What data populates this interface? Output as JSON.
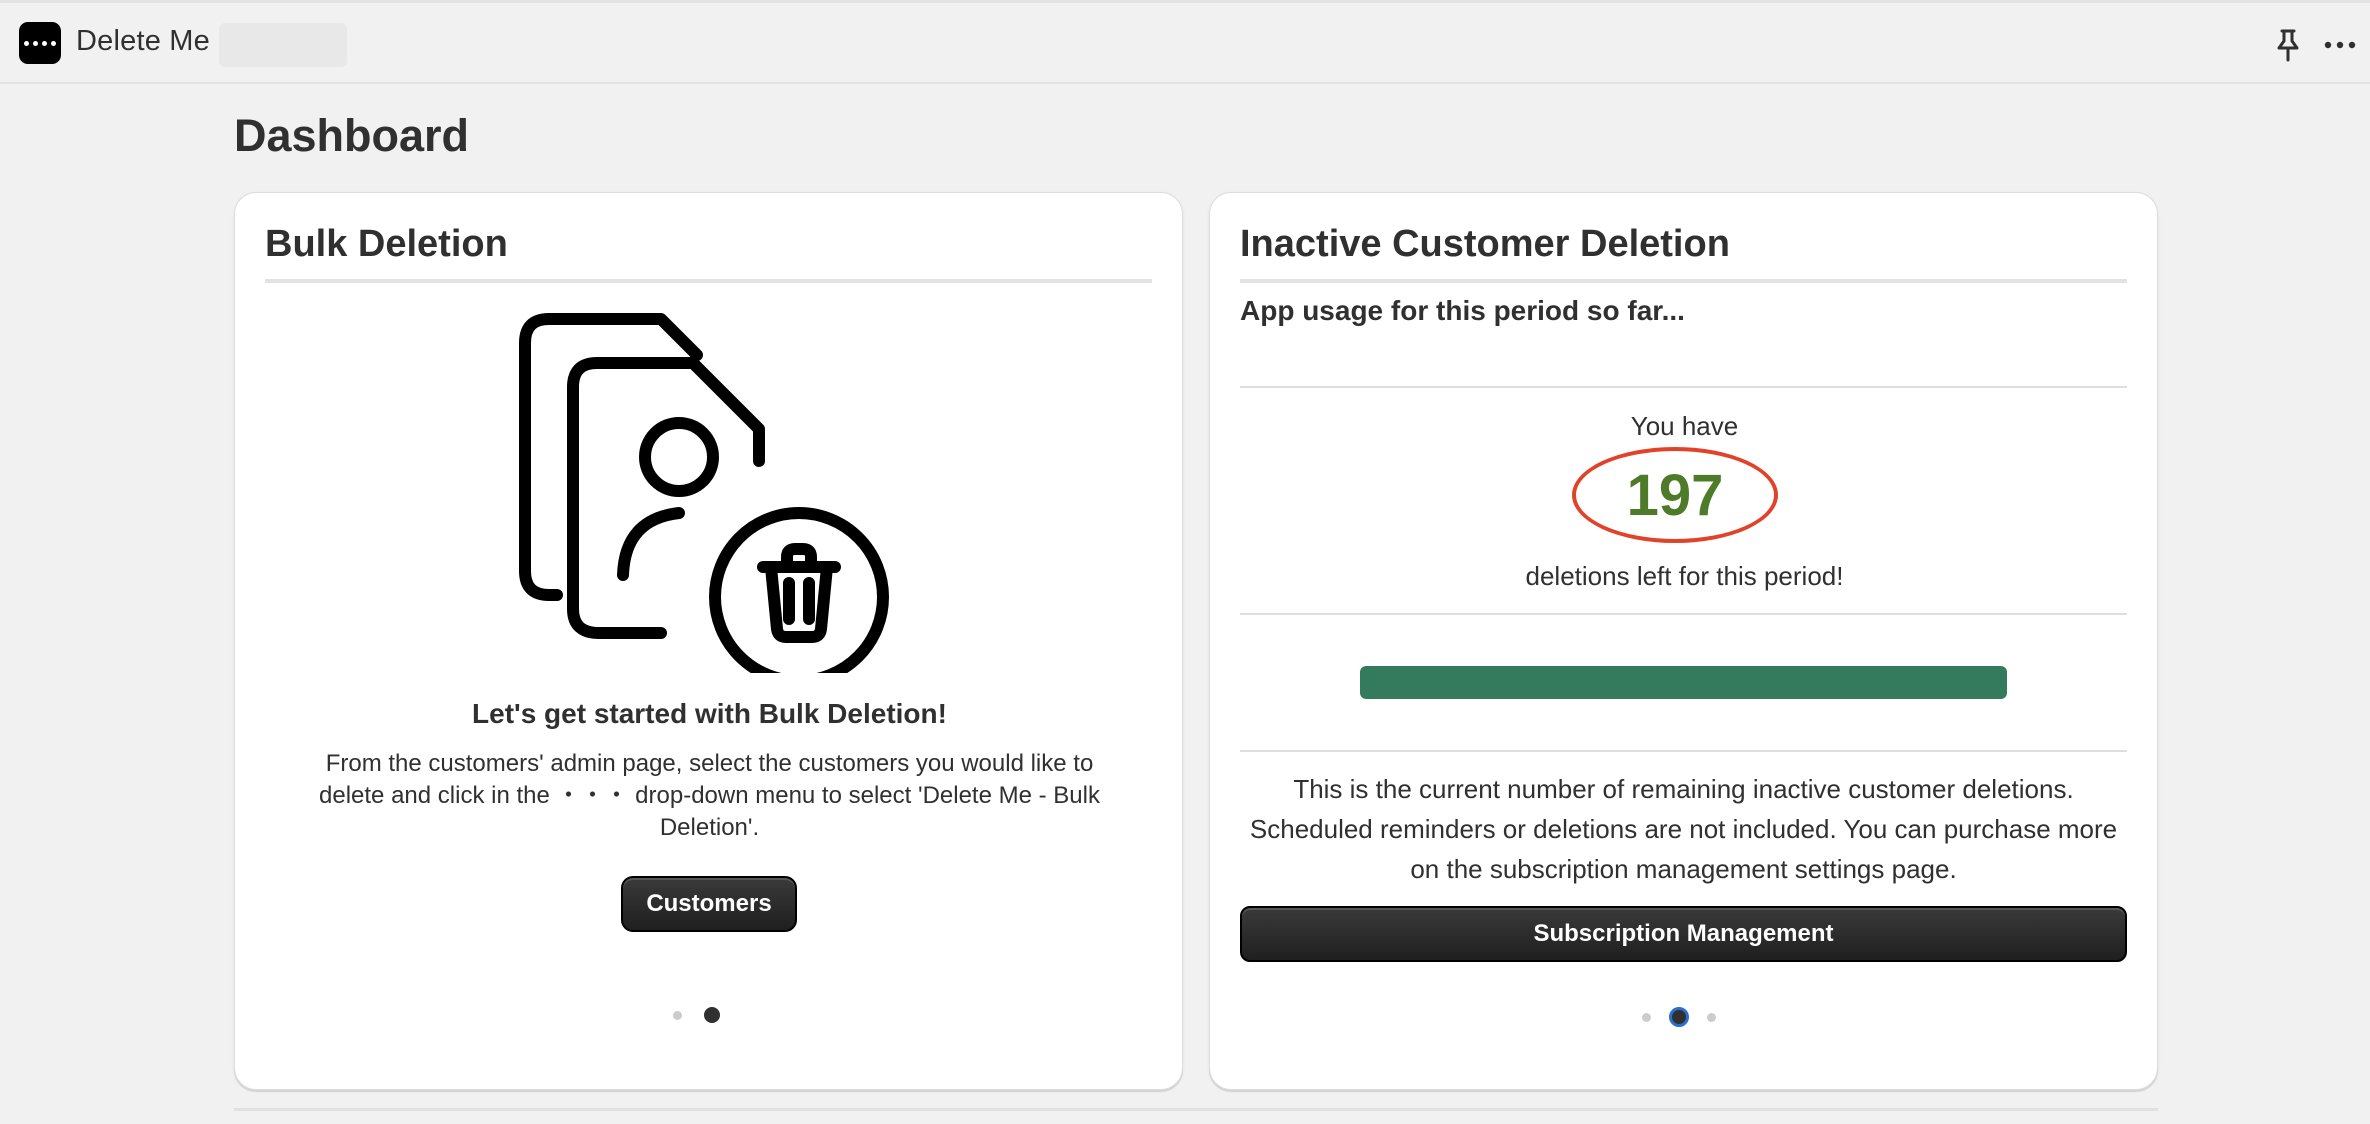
{
  "app": {
    "title": "Delete Me",
    "icon": "app-menu-dots-icon"
  },
  "topbar": {
    "pin_icon": "pin-icon",
    "more_icon": "more-horizontal-icon"
  },
  "page": {
    "title": "Dashboard"
  },
  "bulk_deletion": {
    "heading": "Bulk Deletion",
    "illustration_icon": "delete-customer-documents-icon",
    "subheading": "Let's get started with Bulk Deletion!",
    "description": "From the customers' admin page, select the customers you would like to delete and click in the  ・・・  drop-down menu to select 'Delete Me - Bulk Deletion'.",
    "button_label": "Customers",
    "carousel": {
      "count": 2,
      "active_index": 1
    }
  },
  "inactive_deletion": {
    "heading": "Inactive Customer Deletion",
    "subtitle": "App usage for this period so far...",
    "you_have": "You have",
    "remaining_count": "197",
    "deletions_left": "deletions left for this period!",
    "progress_fraction": 1.0,
    "description": "This is the current number of remaining inactive customer deletions. Scheduled reminders or deletions are not included. You can purchase more on the subscription management settings page.",
    "button_label": "Subscription Management",
    "carousel": {
      "count": 3,
      "active_index": 1
    }
  },
  "colors": {
    "accent_green": "#347a5c",
    "count_green": "#4e7b2a",
    "highlight_red": "#e0432a",
    "button_dark": "#303030"
  }
}
